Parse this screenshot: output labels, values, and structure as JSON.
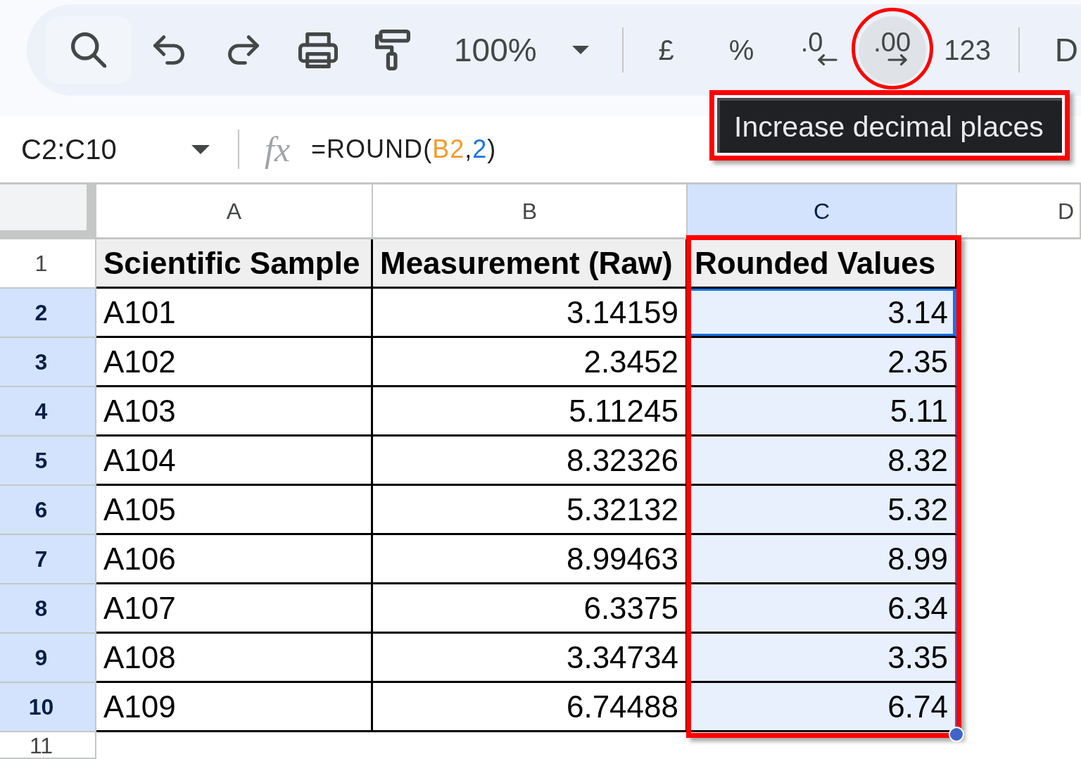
{
  "toolbar": {
    "zoom": "100%",
    "format_buttons": [
      {
        "kind": "currency",
        "label": "£",
        "hovered": false,
        "highlighted": false
      },
      {
        "kind": "percent",
        "label": "%",
        "hovered": false,
        "highlighted": false
      },
      {
        "kind": "decrease_decimal",
        "label": ".0",
        "hovered": false,
        "highlighted": false
      },
      {
        "kind": "increase_decimal",
        "label": ".00",
        "hovered": true,
        "highlighted": true
      },
      {
        "kind": "number_format",
        "label": "123",
        "hovered": false,
        "highlighted": false
      }
    ],
    "font": "D"
  },
  "tooltip": {
    "text": "Increase decimal places",
    "highlighted": true
  },
  "formula_bar": {
    "name_box": "C2:C10",
    "fx_symbol": "fx",
    "formula": [
      {
        "kind": "function",
        "text": "=ROUND"
      },
      {
        "kind": "paren",
        "text": "("
      },
      {
        "kind": "range",
        "text": "B2"
      },
      {
        "kind": "separator",
        "text": ","
      },
      {
        "kind": "number",
        "text": "2"
      },
      {
        "kind": "paren",
        "text": ")"
      }
    ]
  },
  "sheet": {
    "columns": [
      {
        "label": "A",
        "selected": false,
        "highlighted": false
      },
      {
        "label": "B",
        "selected": false,
        "highlighted": false
      },
      {
        "label": "C",
        "selected": true,
        "highlighted": true
      },
      {
        "label": "D",
        "selected": false,
        "highlighted": false
      }
    ],
    "rows": [
      {
        "number": "1",
        "selected": false,
        "cells": [
          {
            "text": "Scientific Sample",
            "kind": "header",
            "selected": false,
            "active": false
          },
          {
            "text": "Measurement (Raw)",
            "kind": "header",
            "selected": false,
            "active": false
          },
          {
            "text": "Rounded Values",
            "kind": "header",
            "selected": false,
            "active": false
          }
        ]
      },
      {
        "number": "2",
        "selected": true,
        "cells": [
          {
            "text": "A101",
            "kind": "text",
            "selected": false,
            "active": false
          },
          {
            "text": "3.14159",
            "kind": "number",
            "selected": false,
            "active": false
          },
          {
            "text": "3.14",
            "kind": "number",
            "selected": true,
            "active": true
          }
        ]
      },
      {
        "number": "3",
        "selected": true,
        "cells": [
          {
            "text": "A102",
            "kind": "text",
            "selected": false,
            "active": false
          },
          {
            "text": "2.3452",
            "kind": "number",
            "selected": false,
            "active": false
          },
          {
            "text": "2.35",
            "kind": "number",
            "selected": true,
            "active": false
          }
        ]
      },
      {
        "number": "4",
        "selected": true,
        "cells": [
          {
            "text": "A103",
            "kind": "text",
            "selected": false,
            "active": false
          },
          {
            "text": "5.11245",
            "kind": "number",
            "selected": false,
            "active": false
          },
          {
            "text": "5.11",
            "kind": "number",
            "selected": true,
            "active": false
          }
        ]
      },
      {
        "number": "5",
        "selected": true,
        "cells": [
          {
            "text": "A104",
            "kind": "text",
            "selected": false,
            "active": false
          },
          {
            "text": "8.32326",
            "kind": "number",
            "selected": false,
            "active": false
          },
          {
            "text": "8.32",
            "kind": "number",
            "selected": true,
            "active": false
          }
        ]
      },
      {
        "number": "6",
        "selected": true,
        "cells": [
          {
            "text": "A105",
            "kind": "text",
            "selected": false,
            "active": false
          },
          {
            "text": "5.32132",
            "kind": "number",
            "selected": false,
            "active": false
          },
          {
            "text": "5.32",
            "kind": "number",
            "selected": true,
            "active": false
          }
        ]
      },
      {
        "number": "7",
        "selected": true,
        "cells": [
          {
            "text": "A106",
            "kind": "text",
            "selected": false,
            "active": false
          },
          {
            "text": "8.99463",
            "kind": "number",
            "selected": false,
            "active": false
          },
          {
            "text": "8.99",
            "kind": "number",
            "selected": true,
            "active": false
          }
        ]
      },
      {
        "number": "8",
        "selected": true,
        "cells": [
          {
            "text": "A107",
            "kind": "text",
            "selected": false,
            "active": false
          },
          {
            "text": "6.3375",
            "kind": "number",
            "selected": false,
            "active": false
          },
          {
            "text": "6.34",
            "kind": "number",
            "selected": true,
            "active": false
          }
        ]
      },
      {
        "number": "9",
        "selected": true,
        "cells": [
          {
            "text": "A108",
            "kind": "text",
            "selected": false,
            "active": false
          },
          {
            "text": "3.34734",
            "kind": "number",
            "selected": false,
            "active": false
          },
          {
            "text": "3.35",
            "kind": "number",
            "selected": true,
            "active": false
          }
        ]
      },
      {
        "number": "10",
        "selected": true,
        "cells": [
          {
            "text": "A109",
            "kind": "text",
            "selected": false,
            "active": false
          },
          {
            "text": "6.74488",
            "kind": "number",
            "selected": false,
            "active": false
          },
          {
            "text": "6.74",
            "kind": "number",
            "selected": true,
            "active": false
          }
        ]
      },
      {
        "number": "11",
        "selected": false
      }
    ]
  }
}
